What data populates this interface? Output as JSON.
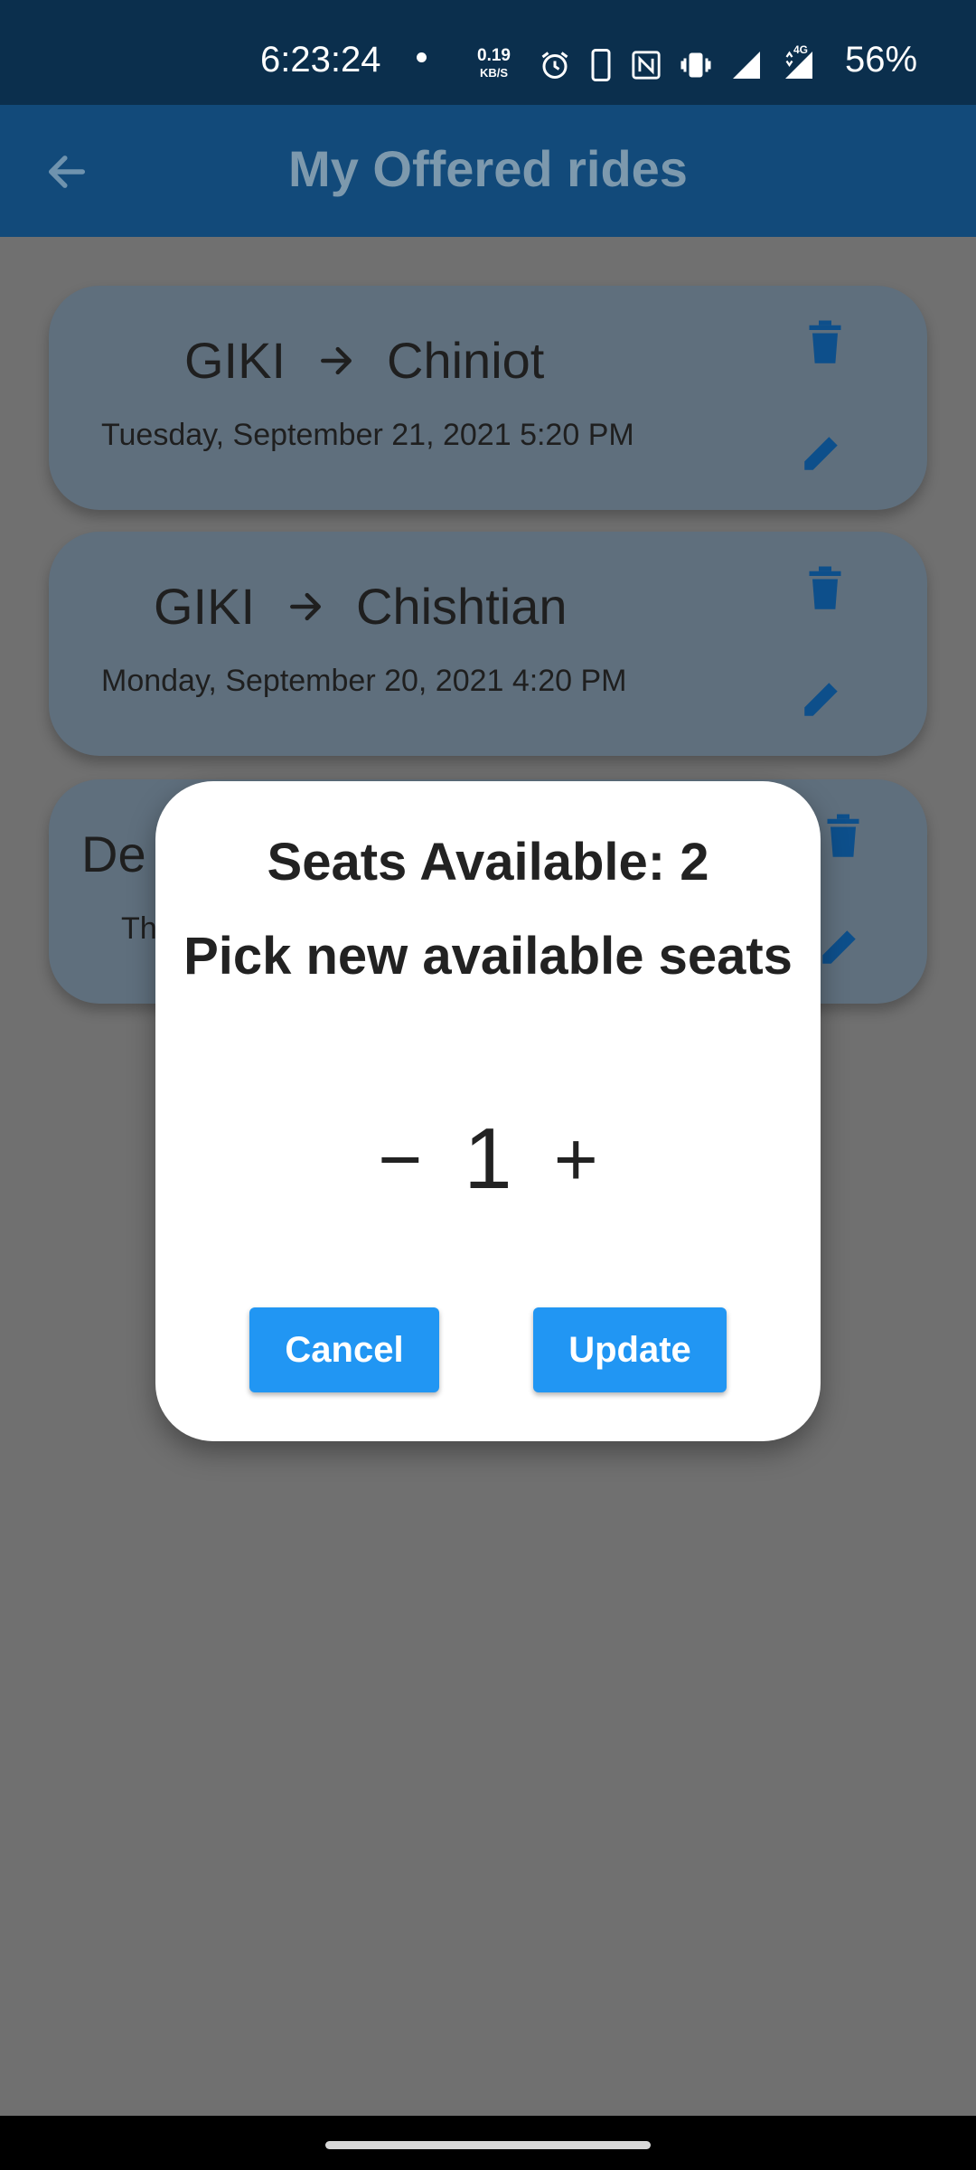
{
  "status_bar": {
    "time": "6:23:24",
    "net_speed_value": "0.19",
    "net_speed_unit": "KB/S",
    "network_label": "4G",
    "battery": "56%"
  },
  "app_bar": {
    "title": "My Offered rides"
  },
  "rides": [
    {
      "from": "GIKI",
      "to": "Chiniot",
      "datetime": "Tuesday, September 21, 2021 5:20 PM"
    },
    {
      "from": "GIKI",
      "to": "Chishtian",
      "datetime": "Monday, September 20, 2021 4:20 PM"
    },
    {
      "from_partial": "De",
      "date_partial": "Th"
    }
  ],
  "dialog": {
    "title": "Seats Available: 2",
    "subtitle": "Pick new available seats",
    "decrement": "−",
    "value": "1",
    "increment": "+",
    "cancel_label": "Cancel",
    "update_label": "Update"
  },
  "colors": {
    "accent": "#2196f3",
    "app_bar": "#124a7a",
    "status_bar": "#0b2f4d",
    "icon": "#0d4f8b"
  }
}
